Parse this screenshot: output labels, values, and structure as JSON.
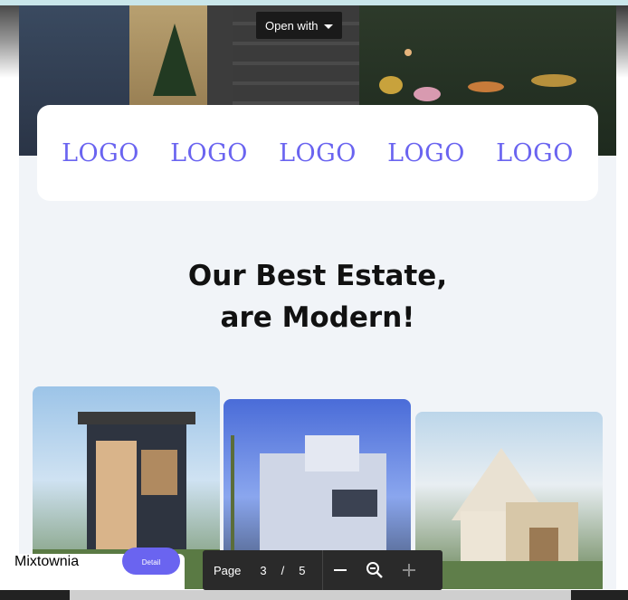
{
  "viewer": {
    "open_with_label": "Open with",
    "page_label": "Page",
    "current_page": "3",
    "separator": "/",
    "total_pages": "5"
  },
  "logos": [
    "LOGO",
    "LOGO",
    "LOGO",
    "LOGO",
    "LOGO"
  ],
  "headline": {
    "line1": "Our Best Estate,",
    "line2": "are Modern!"
  },
  "cards": [
    {
      "title": "Mixtownia",
      "button_label": "Detail"
    }
  ],
  "icons": {
    "caret": "chevron-down-icon",
    "zoom_out_line": "minus-icon",
    "zoom": "zoom-out-icon",
    "zoom_in": "plus-icon"
  },
  "colors": {
    "accent": "#6a64f0",
    "viewer_bar": "#2a2a2a",
    "page_bg": "#f1f4f8"
  }
}
